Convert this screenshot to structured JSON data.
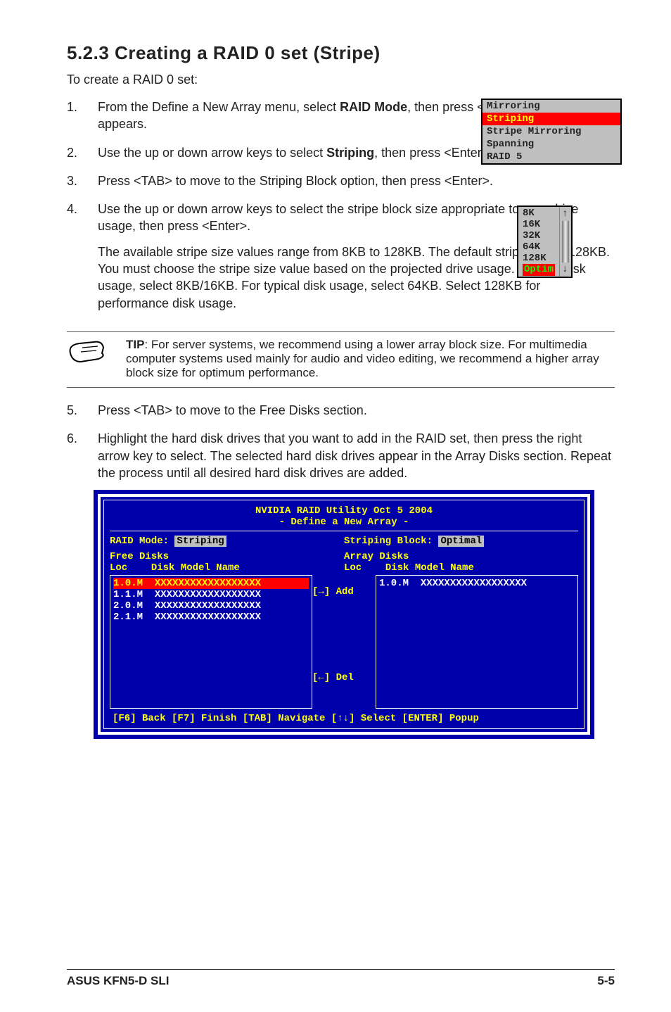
{
  "heading": "5.2.3   Creating a RAID 0 set (Stripe)",
  "intro": "To create a RAID 0 set:",
  "steps": [
    {
      "num": "1.",
      "parts": [
        "From the Define a New Array menu, select ",
        "RAID Mode",
        ", then press <Enter>. A pop-up menu appears."
      ]
    },
    {
      "num": "2.",
      "parts": [
        "Use the up or down arrow keys to select ",
        "Striping",
        ", then press <Enter>."
      ]
    },
    {
      "num": "3.",
      "parts": [
        "Press <TAB> to move to the Striping Block option, then press <Enter>."
      ]
    },
    {
      "num": "4.",
      "parts": [
        "Use the up or down arrow keys to select the stripe block size appropriate to your drive usage, then press <Enter>."
      ],
      "extra": "The available stripe size values range from 8KB to 128KB. The default stripe size is 128KB. You must choose the stripe size value based on the projected drive usage. For low disk usage, select 8KB/16KB. For typical disk usage, select 64KB. Select 128KB for performance disk usage."
    }
  ],
  "tip_label": "TIP",
  "tip_text": ": For server systems, we recommend using a lower array block size. For multimedia computer systems used mainly for audio and video editing, we recommend a higher array block size for optimum performance.",
  "steps_b": [
    {
      "num": "5.",
      "text": "Press <TAB> to move to the Free Disks section."
    },
    {
      "num": "6.",
      "text": "Highlight the hard disk drives that you want to add in the RAID set, then press the right arrow key to select. The selected hard disk drives appear in the Array Disks section. Repeat the process until all desired hard disk drives are added."
    }
  ],
  "popup_mode": {
    "items": [
      "Mirroring",
      "Striping",
      "Stripe Mirroring",
      "Spanning",
      "RAID 5"
    ],
    "selected": "Striping"
  },
  "popup_block": {
    "items": [
      "8K",
      "16K",
      "32K",
      "64K",
      "128K",
      "Optim"
    ],
    "selected": "Optim",
    "up": "↑",
    "down": "↓"
  },
  "bios": {
    "title": "NVIDIA RAID Utility  Oct 5 2004",
    "subtitle": "- Define a New Array -",
    "raid_mode_label": "RAID Mode:",
    "raid_mode_value": "Striping",
    "striping_block_label": "Striping Block:",
    "striping_block_value": "Optimal",
    "free_disks_label": "Free Disks",
    "array_disks_label": "Array Disks",
    "loc_label": "Loc",
    "model_label": "Disk Model Name",
    "free_disks": [
      {
        "loc": "1.0.M",
        "model": "XXXXXXXXXXXXXXXXXX",
        "sel": true
      },
      {
        "loc": "1.1.M",
        "model": "XXXXXXXXXXXXXXXXXX",
        "sel": false
      },
      {
        "loc": "2.0.M",
        "model": "XXXXXXXXXXXXXXXXXX",
        "sel": false
      },
      {
        "loc": "2.1.M",
        "model": "XXXXXXXXXXXXXXXXXX",
        "sel": false
      }
    ],
    "array_disks": [
      {
        "loc": "1.0.M",
        "model": "XXXXXXXXXXXXXXXXXX"
      }
    ],
    "add_label": "[→] Add",
    "del_label": "[←] Del",
    "footer": "[F6] Back  [F7] Finish  [TAB] Navigate  [↑↓] Select  [ENTER] Popup"
  },
  "footer_left": "ASUS KFN5-D SLI",
  "footer_right": "5-5"
}
